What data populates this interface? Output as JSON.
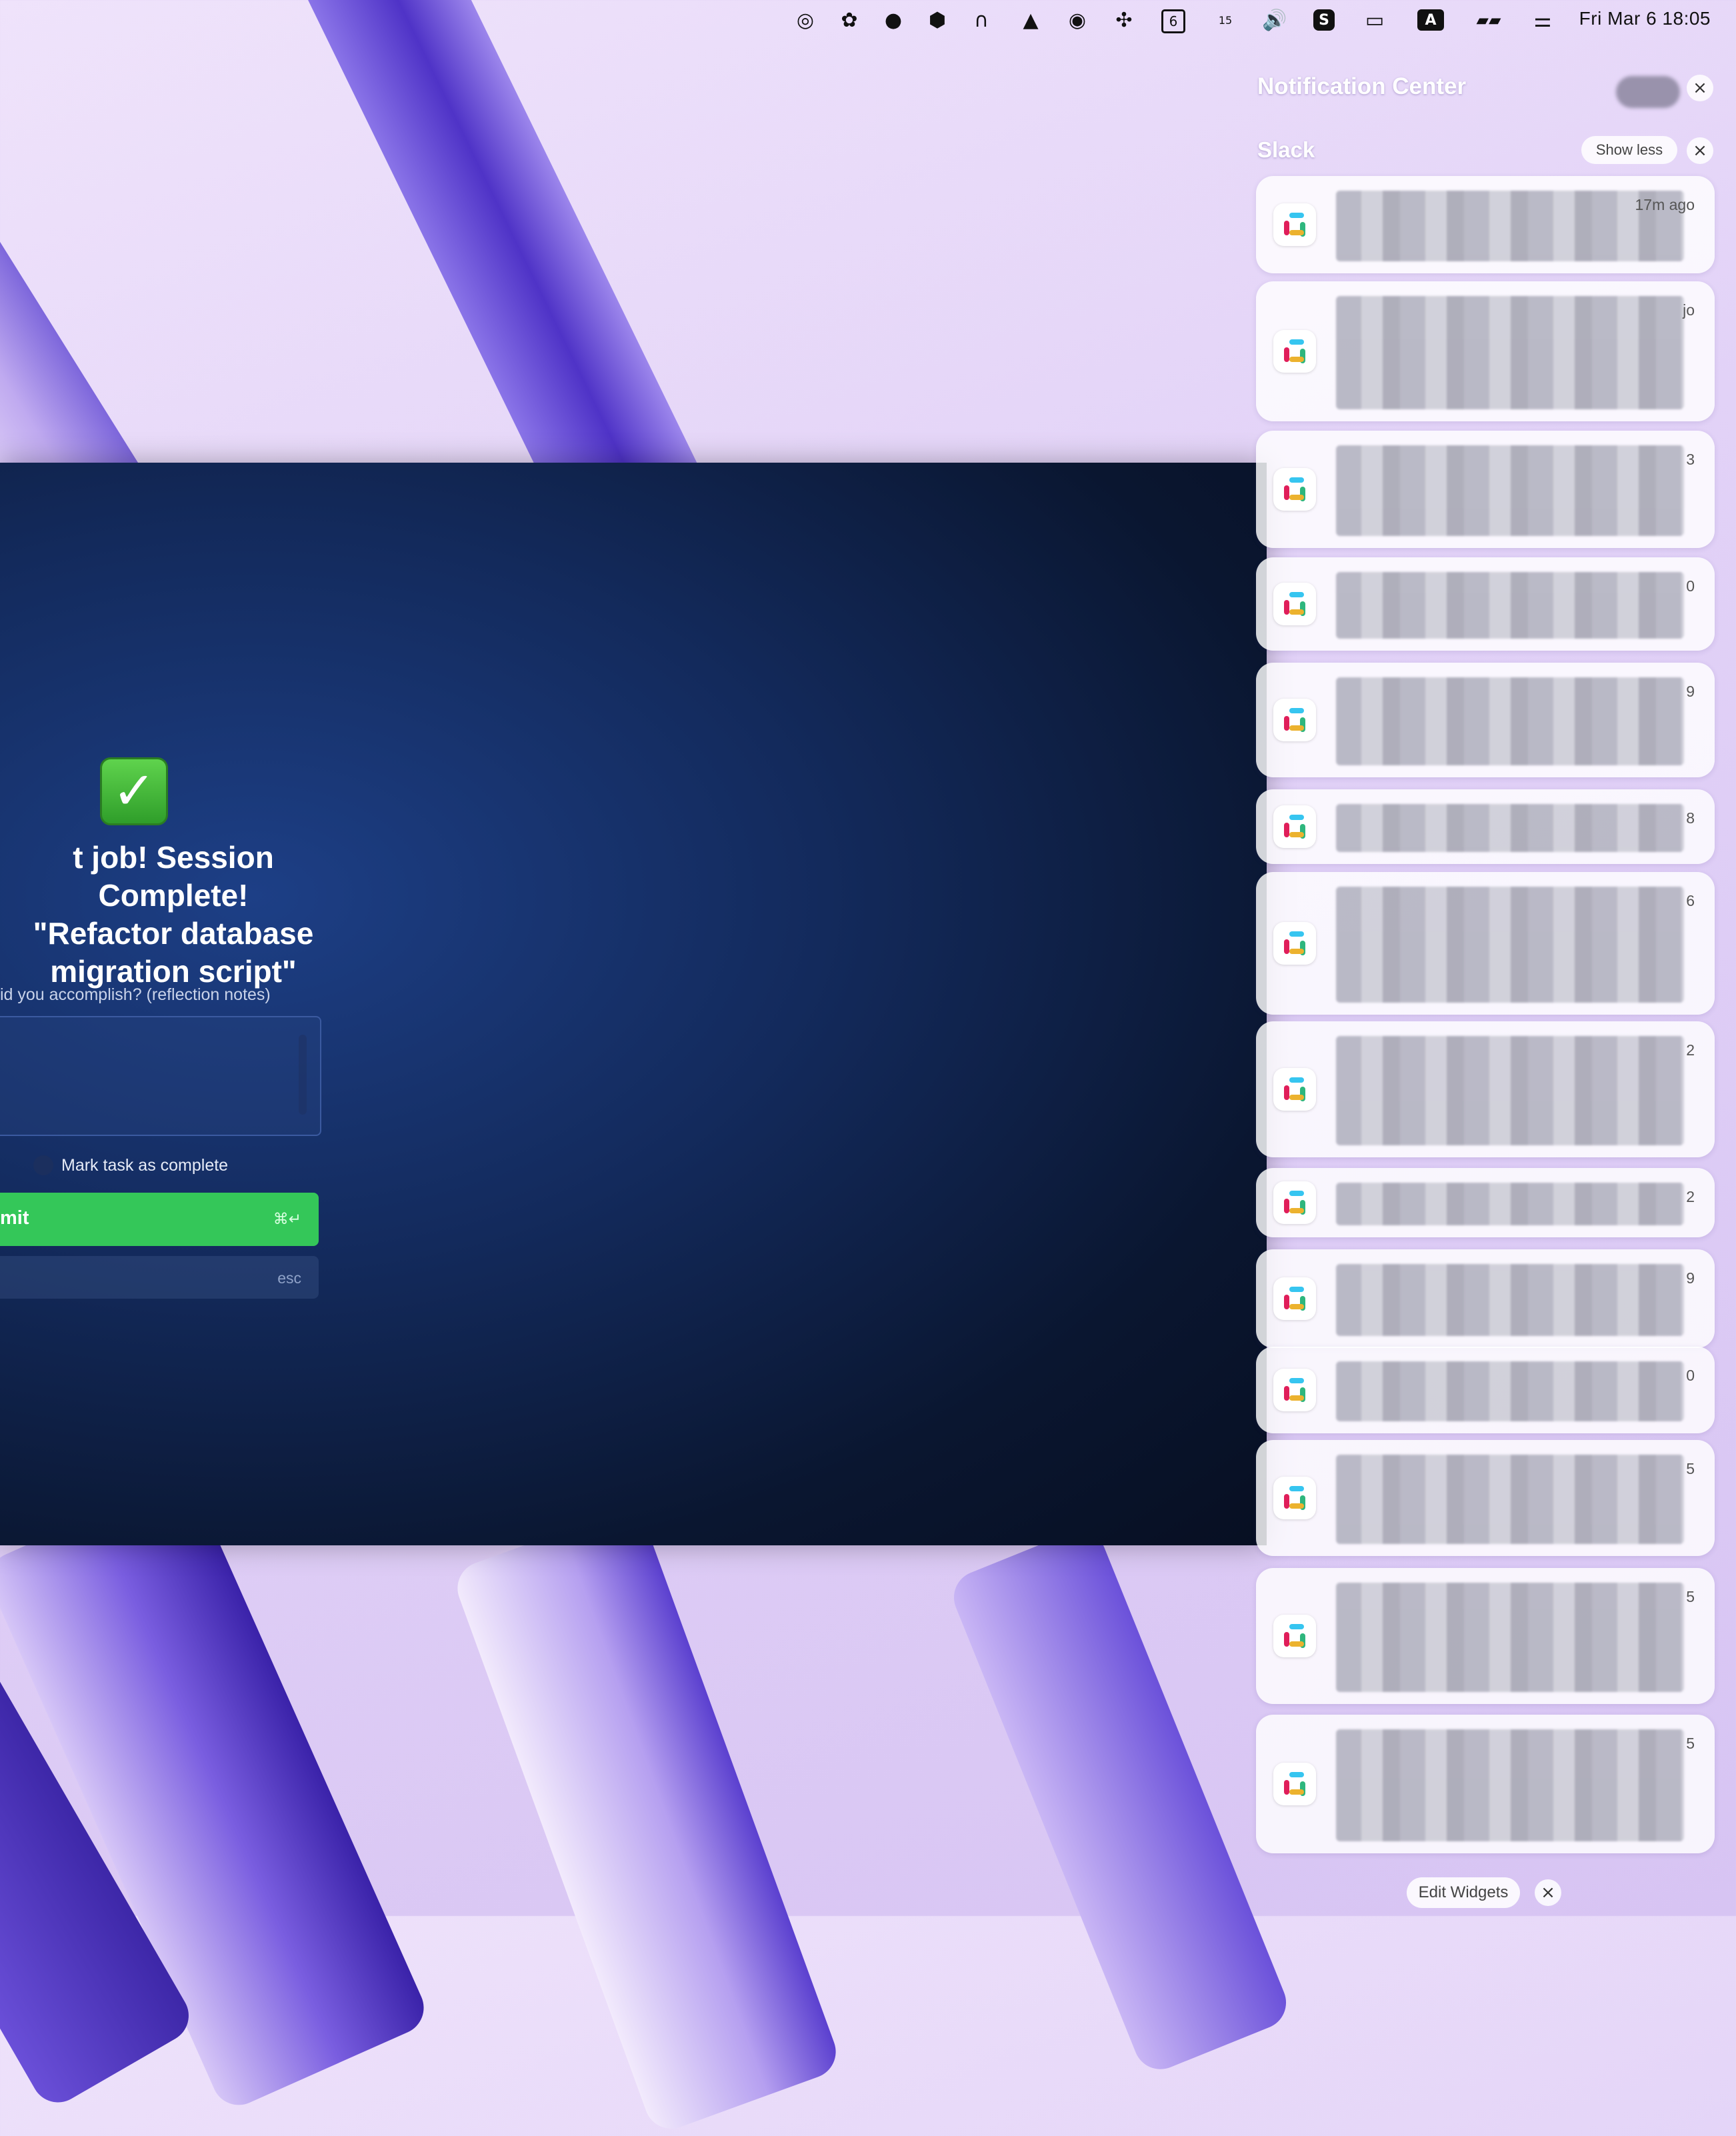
{
  "menubar": {
    "icons": [
      "record-icon",
      "chatgpt-icon",
      "bomb-icon",
      "box-icon",
      "tunnel-icon",
      "mountain-icon",
      "spiral-icon",
      "sync-icon",
      "calendar-icon",
      "cloud-icon",
      "volume-icon",
      "s-app-icon",
      "display-icon",
      "a-app-icon",
      "battery-icon",
      "control-center-icon"
    ],
    "calendar_day": "6",
    "cloud_badge": "15",
    "s_label": "S",
    "a_label": "A",
    "datetime": "Fri Mar 6  18:05"
  },
  "app": {
    "check_glyph": "✓",
    "title_lines": [
      "t job! Session Complete!",
      "\"Refactor database",
      "migration script\""
    ],
    "reflection_label": "id you accomplish? (reflection notes)",
    "reflection_value": "",
    "mark_complete_label": "Mark task as complete",
    "submit_label": "mit",
    "submit_shortcut": "⌘↵",
    "cancel_shortcut": "esc"
  },
  "notification_center": {
    "title": "Notification Center",
    "close_glyph": "×",
    "group": {
      "name": "Slack",
      "show_less_label": "Show less",
      "close_glyph": "×"
    },
    "notifications": [
      {
        "time": "17m ago"
      },
      {
        "time": "jo"
      },
      {
        "time": "3"
      },
      {
        "time": "0"
      },
      {
        "time": "9"
      },
      {
        "time": "8"
      },
      {
        "time": "6"
      },
      {
        "time": "2"
      },
      {
        "time": "2"
      },
      {
        "time": "9"
      },
      {
        "time": "0"
      },
      {
        "time": "5"
      },
      {
        "time": "5"
      },
      {
        "time": "5"
      }
    ],
    "edit_widgets_label": "Edit Widgets",
    "edit_close_glyph": "×"
  },
  "colors": {
    "accent_green": "#34c759",
    "panel_dark": "#0a1630"
  }
}
